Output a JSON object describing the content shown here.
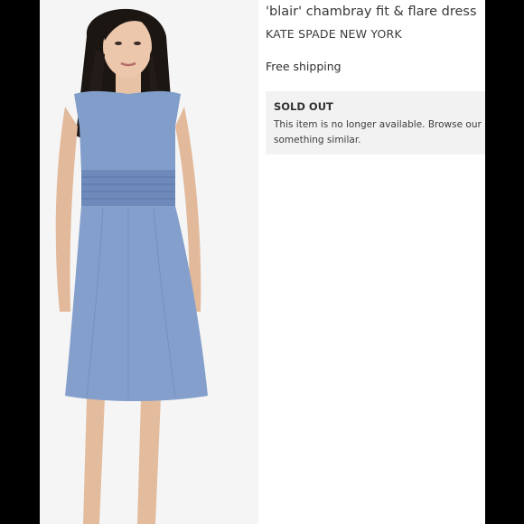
{
  "product": {
    "title": "'blair' chambray fit & flare dress",
    "brand": "KATE SPADE NEW YORK",
    "shipping": "Free shipping"
  },
  "availability": {
    "status": "SOLD OUT",
    "message_line1": "This item is no longer available. Browse our rec",
    "message_line2": "something similar."
  },
  "colors": {
    "frame": "#000000",
    "notice_background": "#f2f2f2",
    "dress": "#7f9bc8"
  }
}
